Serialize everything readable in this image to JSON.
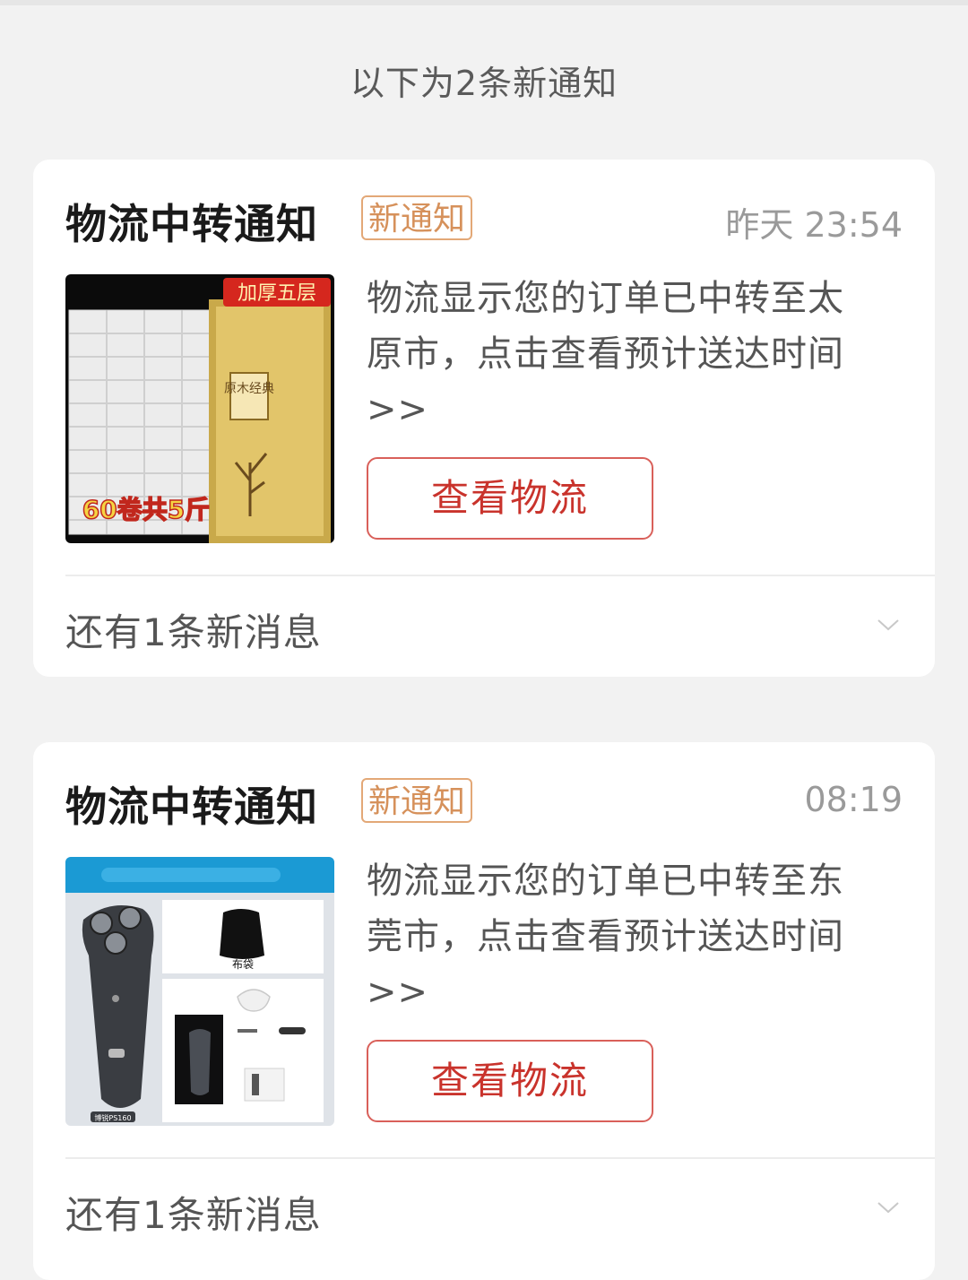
{
  "header": {
    "text": "以下为2条新通知"
  },
  "notifications": [
    {
      "title": "物流中转通知",
      "badge": "新通知",
      "time": "昨天 23:54",
      "message_line1": "物流显示您的订单已中转至太",
      "message_line2": "原市，点击查看预计送达时间",
      "message_line3": ">>",
      "button_label": "查看物流",
      "more_text": "还有1条新消息",
      "image": {
        "label_top": "加厚五层",
        "label_bottom": "60卷共5斤",
        "box_text": "原木经典"
      }
    },
    {
      "title": "物流中转通知",
      "badge": "新通知",
      "time": "08:19",
      "message_line1": "物流显示您的订单已中转至东",
      "message_line2": "莞市，点击查看预计送达时间",
      "message_line3": ">>",
      "button_label": "查看物流",
      "more_text": "还有1条新消息",
      "image": {
        "label_bag": "布袋",
        "label_model": "博锐PS160"
      }
    }
  ],
  "colors": {
    "accent_red": "#c9332c",
    "badge_orange": "#d6915b",
    "background": "#f2f2f2"
  }
}
